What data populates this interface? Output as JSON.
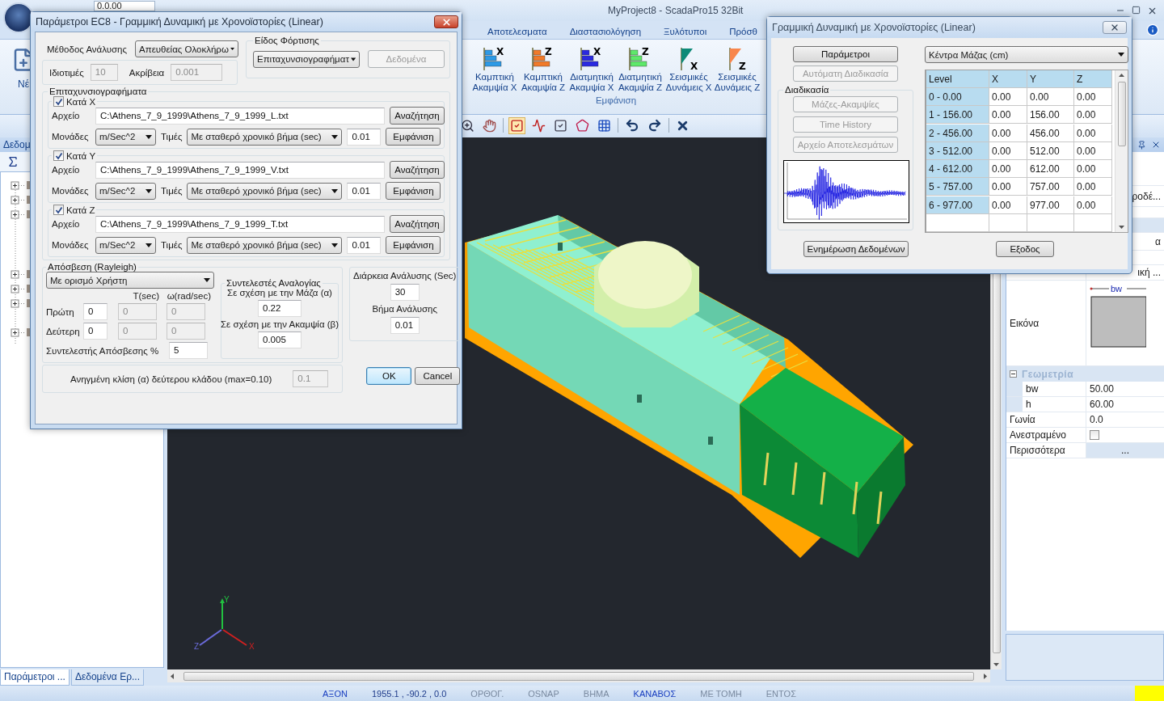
{
  "app": {
    "title": "MyProject8 - ScadaPro15 32Bit",
    "quick_value": "0.0.00",
    "new_label": "Νέ"
  },
  "ribbon": {
    "tabs": [
      {
        "label": "Αποτελεσματα",
        "selected": false
      },
      {
        "label": "Διαστασιολόγηση",
        "selected": false
      },
      {
        "label": "Ξυλότυποι",
        "selected": false
      },
      {
        "label": "Πρόσθ",
        "selected": false
      }
    ],
    "group_label": "Εμφάνιση",
    "buttons": [
      {
        "kind": "bars",
        "color": "#2d9ae6",
        "axis": "X",
        "line1": "Καμπτική",
        "line2": "Ακαμψία X"
      },
      {
        "kind": "bars",
        "color": "#f07a2a",
        "axis": "Z",
        "line1": "Καμπτική",
        "line2": "Ακαμψία Z"
      },
      {
        "kind": "bars",
        "color": "#2a2ae0",
        "axis": "X",
        "line1": "Διατμητική",
        "line2": "Ακαμψία X"
      },
      {
        "kind": "bars",
        "color": "#5ee86a",
        "axis": "Z",
        "line1": "Διατμητική",
        "line2": "Ακαμψία Z"
      },
      {
        "kind": "flag",
        "color": "#0e8a78",
        "axis": "X",
        "line1": "Σεισμικές",
        "line2": "Δυνάμεις X"
      },
      {
        "kind": "flag",
        "color": "#f8864c",
        "axis": "Z",
        "line1": "Σεισμικές",
        "line2": "Δυνάμεις Z"
      }
    ]
  },
  "left_panel": {
    "title": "Δεδομ",
    "tabs": [
      {
        "label": "Παράμετροι ...",
        "selected": true
      },
      {
        "label": "Δεδομένα Ερ...",
        "selected": false
      }
    ]
  },
  "viewport": {
    "axes": [
      "X",
      "Y",
      "Z"
    ]
  },
  "properties": {
    "partial_values": [
      "ροδέ...",
      "α",
      "ική ..."
    ],
    "image_label": "Εικόνα",
    "image_dimension": "bw",
    "group": "Γεωμετρία",
    "rows": [
      {
        "kind": "sub",
        "name": "bw",
        "value": "50.00"
      },
      {
        "kind": "sub",
        "name": "h",
        "value": "60.00"
      },
      {
        "kind": "text",
        "name": "Γωνία",
        "value": "0.0"
      },
      {
        "kind": "check",
        "name": "Ανεστραμένο",
        "checked": false
      },
      {
        "kind": "more",
        "name": "Περισσότερα",
        "value": "..."
      }
    ]
  },
  "status_bar": [
    {
      "kind": "toggle",
      "label": "ΑΞΟΝ",
      "on": true
    },
    {
      "kind": "reading",
      "label": "1955.1 , -90.2 , 0.0"
    },
    {
      "kind": "toggle",
      "label": "ΟΡΘΟΓ.",
      "on": false
    },
    {
      "kind": "toggle",
      "label": "OSNAP",
      "on": false
    },
    {
      "kind": "toggle",
      "label": "ΒΗΜΑ",
      "on": false
    },
    {
      "kind": "toggle",
      "label": "ΚΑΝΑΒΟΣ",
      "on": true
    },
    {
      "kind": "toggle",
      "label": "ΜΕ ΤΟΜΗ",
      "on": false
    },
    {
      "kind": "toggle",
      "label": "ΕΝΤΟΣ",
      "on": false
    }
  ],
  "params_dialog": {
    "title": "Παράμετροι EC8 - Γραμμική Δυναμική με Χρονοϊστορίες (Linear)",
    "method_label": "Μέθοδος Ανάλυσης",
    "method": "Απευθείας Ολοκλήρω",
    "eigen_label": "Ιδιοτιμές",
    "eigen": {
      "value": "10",
      "disabled": true
    },
    "accuracy_label": "Ακρίβεια",
    "accuracy": {
      "value": "0.001",
      "disabled": true
    },
    "loading": {
      "title": "Είδος Φόρτισης",
      "type": "Επιταχυνσιογραφήματ",
      "data_button": {
        "label": "Δεδομένα",
        "disabled": true
      }
    },
    "accel": {
      "title": "Επιταχυνσιογραφήματα",
      "axes": [
        {
          "label": "Κατά X",
          "checked": true,
          "file_label": "Αρχείο",
          "file": "C:\\Athens_7_9_1999\\Athens_7_9_1999_L.txt",
          "browse": "Αναζήτηση",
          "units_label": "Μονάδες",
          "units": "m/Sec^2",
          "values_label": "Τιμές",
          "values": "Με σταθερό χρονικό βήμα (sec)",
          "step": "0.01",
          "show": "Εμφάνιση"
        },
        {
          "label": "Κατά Y",
          "checked": true,
          "file_label": "Αρχείο",
          "file": "C:\\Athens_7_9_1999\\Athens_7_9_1999_V.txt",
          "browse": "Αναζήτηση",
          "units_label": "Μονάδες",
          "units": "m/Sec^2",
          "values_label": "Τιμές",
          "values": "Με σταθερό χρονικό βήμα (sec)",
          "step": "0.01",
          "show": "Εμφάνιση"
        },
        {
          "label": "Κατά Z",
          "checked": true,
          "file_label": "Αρχείο",
          "file": "C:\\Athens_7_9_1999\\Athens_7_9_1999_T.txt",
          "browse": "Αναζήτηση",
          "units_label": "Μονάδες",
          "units": "m/Sec^2",
          "values_label": "Τιμές",
          "values": "Με σταθερό χρονικό βήμα (sec)",
          "step": "0.01",
          "show": "Εμφάνιση"
        }
      ]
    },
    "damping": {
      "title": "Απόσβεση (Rayleigh)",
      "mode": "Με ορισμό Χρήστη",
      "headers": [
        "T(sec)",
        "ω(rad/sec)"
      ],
      "rows": [
        {
          "label": "Πρώτη",
          "cells": [
            {
              "value": "0",
              "disabled": false
            },
            {
              "value": "0",
              "disabled": true
            },
            {
              "value": "0",
              "disabled": true
            }
          ]
        },
        {
          "label": "Δεύτερη",
          "cells": [
            {
              "value": "0",
              "disabled": false
            },
            {
              "value": "0",
              "disabled": true
            },
            {
              "value": "0",
              "disabled": true
            }
          ]
        }
      ],
      "ratio_label": "Συντελεστής Απόσβεσης %",
      "ratio": "5",
      "coeffs": {
        "title": "Συντελεστές Αναλογίας",
        "items": [
          {
            "label": "Σε σχέση με την Μάζα (α)",
            "value": "0.22"
          },
          {
            "label": "Σε σχέση με την Ακαμψία (β)",
            "value": "0.005"
          }
        ]
      }
    },
    "duration": {
      "title": "Διάρκεια Ανάλυσης (Sec)",
      "value": "30",
      "step_label": "Βήμα Ανάλυσης",
      "step": "0.01"
    },
    "slope_label": "Ανηγμένη κλίση (α) δεύτερου κλάδου (max=0.10)",
    "slope": {
      "value": "0.1",
      "disabled": true
    },
    "buttons": [
      {
        "label": "OK",
        "selected": true
      },
      {
        "label": "Cancel",
        "selected": false
      }
    ]
  },
  "results_dialog": {
    "title": "Γραμμική Δυναμική με Χρονοϊστορίες (Linear)",
    "top_buttons": [
      {
        "label": "Παράμετροι",
        "disabled": false
      },
      {
        "label": "Αυτόματη Διαδικασία",
        "disabled": true
      }
    ],
    "procedure": {
      "title": "Διαδικασία",
      "buttons": [
        {
          "label": "Μάζες-Ακαμψίες",
          "disabled": true
        },
        {
          "label": "Time History",
          "disabled": true
        },
        {
          "label": "Αρχείο Αποτελεσμάτων",
          "disabled": true
        }
      ]
    },
    "view_select": "Κέντρα Μάζας (cm)",
    "table": {
      "columns": [
        "Level",
        "X",
        "Y",
        "Z"
      ],
      "rows": [
        [
          "0 - 0.00",
          "0.00",
          "0.00",
          "0.00"
        ],
        [
          "1 - 156.00",
          "0.00",
          "156.00",
          "0.00"
        ],
        [
          "2 - 456.00",
          "0.00",
          "456.00",
          "0.00"
        ],
        [
          "3 - 512.00",
          "0.00",
          "512.00",
          "0.00"
        ],
        [
          "4 - 612.00",
          "0.00",
          "612.00",
          "0.00"
        ],
        [
          "5 - 757.00",
          "0.00",
          "757.00",
          "0.00"
        ],
        [
          "6 - 977.00",
          "0.00",
          "977.00",
          "0.00"
        ]
      ]
    },
    "footer_buttons": [
      {
        "label": "Ενημέρωση Δεδομένων",
        "disabled": false
      },
      {
        "label": "Εξοδος",
        "disabled": false
      }
    ]
  }
}
